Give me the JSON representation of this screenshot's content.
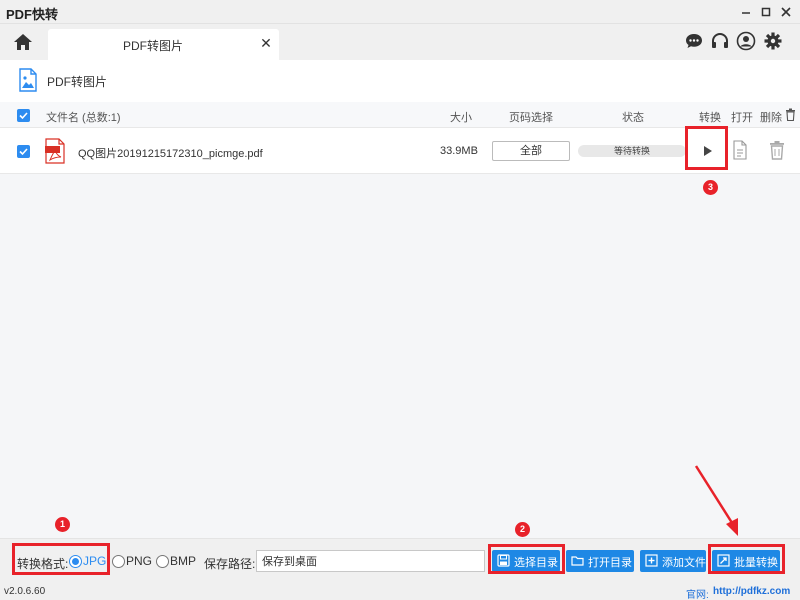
{
  "window": {
    "title": "PDF快转"
  },
  "tab": {
    "label": "PDF转图片",
    "close": "✕"
  },
  "section": {
    "title": "PDF转图片"
  },
  "list_header": {
    "filename": "文件名 (总数:1)",
    "size": "大小",
    "page_select": "页码选择",
    "status": "状态",
    "convert": "转换",
    "open": "打开",
    "delete": "删除"
  },
  "files": [
    {
      "name": "QQ图片20191215172310_picmge.pdf",
      "size": "33.9MB",
      "pages": "全部",
      "status": "等待转换"
    }
  ],
  "bottom": {
    "format_label": "转换格式:",
    "formats": [
      "JPG",
      "PNG",
      "BMP"
    ],
    "selected_format": "JPG",
    "save_path_label": "保存路径:",
    "save_path_value": "保存到桌面",
    "buttons": {
      "choose_dir": "选择目录",
      "open_dir": "打开目录",
      "add_file": "添加文件",
      "batch_convert": "批量转换"
    }
  },
  "statusline": {
    "version": "v2.0.6.60",
    "site_label": "官网:",
    "site_url": "http://pdfkz.com"
  },
  "annotations": {
    "markers": [
      "1",
      "2",
      "3"
    ]
  },
  "colors": {
    "accent": "#1e88e5",
    "highlight": "#e8222a",
    "pdf_red": "#d93025"
  }
}
